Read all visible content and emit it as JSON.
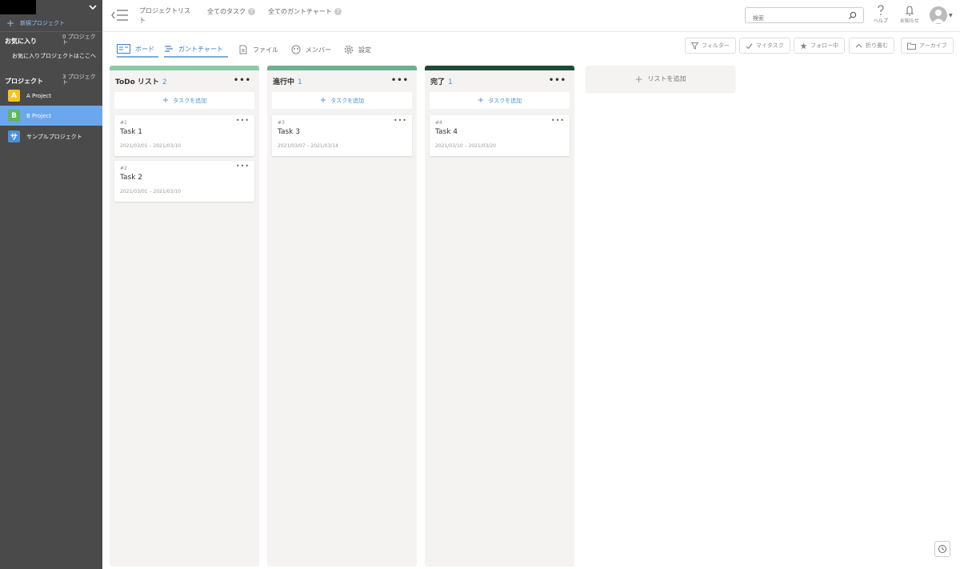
{
  "sidebar": {
    "new_project": "新規プロジェクト",
    "favorites": {
      "title": "お気に入り",
      "count": "0 プロジェクト",
      "empty": "お気に入りプロジェクトはここへ"
    },
    "projects": {
      "title": "プロジェクト",
      "count": "3 プロジェクト"
    },
    "items": [
      {
        "badge": "A",
        "label": "A Project",
        "color": "#f5c518",
        "active": false
      },
      {
        "badge": "B",
        "label": "B Project",
        "color": "#5cb85c",
        "active": true
      },
      {
        "badge": "サ",
        "label": "サンプルプロジェクト",
        "color": "#4d8fd6",
        "active": false
      }
    ]
  },
  "header": {
    "project_list": "プロジェクトリスト",
    "all_tasks": "全てのタスク",
    "all_gantt": "全てのガントチャート",
    "search_placeholder": "検索",
    "help_label": "ヘルプ",
    "notifications_label": "お知らせ"
  },
  "tabs": {
    "board": "ボード",
    "gantt": "ガントチャート",
    "files": "ファイル",
    "members": "メンバー",
    "settings": "設定"
  },
  "tools": {
    "filter": "フィルター",
    "my_tasks": "マイタスク",
    "following": "フォロー中",
    "collapse": "折り畳む",
    "archive": "アーカイブ"
  },
  "board": {
    "add_task": "タスクを追加",
    "add_list": "リストを追加",
    "columns": [
      {
        "title": "ToDo リスト",
        "count": "2",
        "color": "#8dc9a6",
        "cards": [
          {
            "num": "#1",
            "title": "Task 1",
            "dates": "2021/03/01 – 2021/03/10"
          },
          {
            "num": "#2",
            "title": "Task 2",
            "dates": "2021/03/01 – 2021/03/10"
          }
        ]
      },
      {
        "title": "進行中",
        "count": "1",
        "color": "#6fb08e",
        "cards": [
          {
            "num": "#3",
            "title": "Task 3",
            "dates": "2021/03/07 – 2021/03/14"
          }
        ]
      },
      {
        "title": "完了",
        "count": "1",
        "color": "#1f4a36",
        "cards": [
          {
            "num": "#4",
            "title": "Task 4",
            "dates": "2021/03/10 – 2021/03/20"
          }
        ]
      }
    ]
  }
}
